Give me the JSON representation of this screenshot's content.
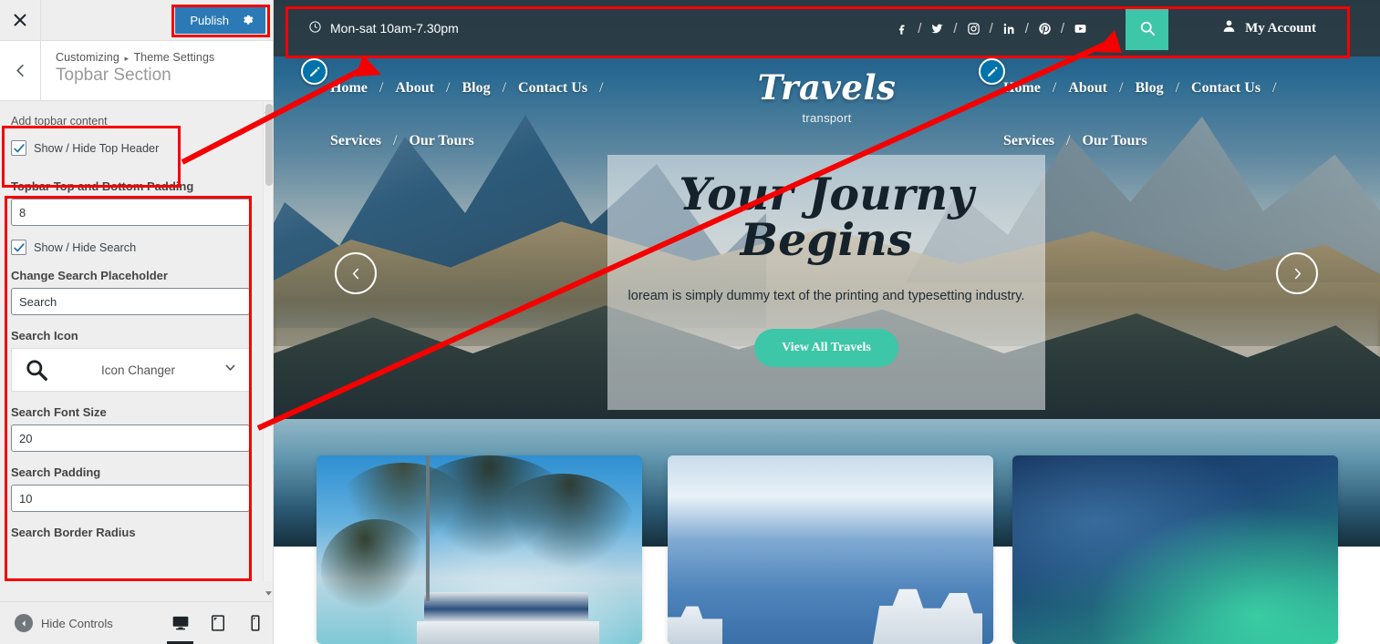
{
  "customizer": {
    "close_label": "×",
    "publish_label": "Publish",
    "gear_icon": "gear-icon",
    "back_icon": "chevron-left-icon",
    "breadcrumb_root": "Customizing",
    "breadcrumb_sep": "▸",
    "breadcrumb_parent": "Theme Settings",
    "section_title": "Topbar Section",
    "controls": {
      "add_topbar_content_label": "Add topbar content",
      "show_hide_top_header_label": "Show / Hide Top Header",
      "show_hide_top_header_checked": true,
      "padding_label": "Topbar Top and Bottom Padding",
      "padding_value": "8",
      "show_hide_search_label": "Show / Hide Search",
      "show_hide_search_checked": true,
      "search_placeholder_label": "Change Search Placeholder",
      "search_placeholder_value": "Search",
      "search_icon_label": "Search Icon",
      "search_icon_glyph": "search-icon",
      "icon_changer_label": "Icon Changer",
      "search_font_size_label": "Search Font Size",
      "search_font_size_value": "20",
      "search_padding_label": "Search Padding",
      "search_padding_value": "10",
      "search_border_radius_label": "Search Border Radius"
    },
    "footer": {
      "hide_controls_label": "Hide Controls",
      "devices": [
        "desktop-icon",
        "tablet-icon",
        "mobile-icon"
      ],
      "active_device": "desktop-icon"
    },
    "colors": {
      "publish_bg": "#2c7ab5",
      "accent": "#0073aa"
    }
  },
  "preview": {
    "topbar": {
      "hours_icon": "clock-icon",
      "hours_text": "Mon-sat 10am-7.30pm",
      "socials": [
        {
          "name": "facebook-icon"
        },
        {
          "name": "twitter-icon"
        },
        {
          "name": "instagram-icon"
        },
        {
          "name": "linkedin-icon"
        },
        {
          "name": "pinterest-icon"
        },
        {
          "name": "youtube-icon"
        }
      ],
      "social_separator": "/",
      "search_icon": "search-icon",
      "search_button_color": "#3dc6a8",
      "account_icon": "user-icon",
      "account_label": "My Account"
    },
    "nav_left": {
      "row1": [
        "Home",
        "About",
        "Blog",
        "Contact Us"
      ],
      "row2": [
        "Services",
        "Our Tours"
      ]
    },
    "nav_right": {
      "row1": [
        "Home",
        "About",
        "Blog",
        "Contact Us"
      ],
      "row2": [
        "Services",
        "Our Tours"
      ]
    },
    "nav_separator": "/",
    "brand": {
      "name": "Travels",
      "subtitle": "transport"
    },
    "hero": {
      "title_line1": "Your Journy",
      "title_line2": "Begins",
      "subtitle": "loream is simply dummy text of the printing and typesetting industry.",
      "button_label": "View All Travels",
      "button_color": "#3dc6a8",
      "prev_icon": "chevron-left-icon",
      "next_icon": "chevron-right-icon"
    },
    "cards": [
      {
        "name": "card-palm-beach"
      },
      {
        "name": "card-coastal-sea"
      },
      {
        "name": "card-aurora"
      }
    ],
    "edit_pencils": [
      {
        "name": "edit-pencil-left"
      },
      {
        "name": "edit-pencil-right"
      }
    ]
  },
  "annotations": {
    "highlight_color": "#f50000",
    "boxes": [
      {
        "name": "publish-button-highlight"
      },
      {
        "name": "add-topbar-content-highlight"
      },
      {
        "name": "topbar-settings-group-highlight"
      },
      {
        "name": "preview-topbar-highlight"
      }
    ],
    "arrows": [
      {
        "name": "arrow-topbar-to-show-hide"
      },
      {
        "name": "arrow-search-button-to-search-icon"
      }
    ]
  }
}
